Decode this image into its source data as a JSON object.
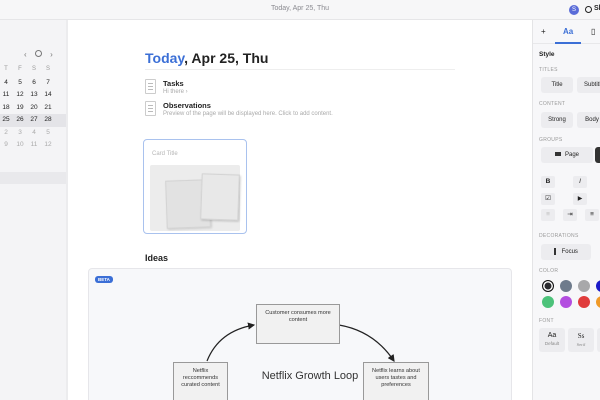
{
  "header": {
    "title": "Today, Apr 25, Thu",
    "avatar": "S",
    "share_label": "Sh"
  },
  "calendar": {
    "weekdays": [
      "T",
      "F",
      "S",
      "S"
    ],
    "weeks": [
      [
        "4",
        "5",
        "6",
        "7"
      ],
      [
        "11",
        "12",
        "13",
        "14"
      ],
      [
        "18",
        "19",
        "20",
        "21"
      ],
      [
        "25",
        "26",
        "27",
        "28"
      ],
      [
        "2",
        "3",
        "4",
        "5"
      ],
      [
        "9",
        "10",
        "11",
        "12"
      ]
    ]
  },
  "doc": {
    "title_highlight": "Today",
    "title_rest": ", Apr 25, Thu",
    "tasks": {
      "title": "Tasks",
      "subtitle": "Hi there ›"
    },
    "observations": {
      "title": "Observations",
      "subtitle": "Preview of the page will be displayed here. Click to add content."
    },
    "card_title": "Card Title",
    "ideas_heading": "Ideas"
  },
  "whiteboard": {
    "badge": "BETA",
    "box_top": "Customer consumes more content",
    "box_left": "Netflix reccommends curated content",
    "box_right": "Netflix learns about users tastes and preferences",
    "title": "Netflix Growth Loop"
  },
  "panel": {
    "tab_add": "+",
    "tab_text": "Aa",
    "section_title": "Style",
    "titles_label": "TITLES",
    "title_btn": "Title",
    "subtitle_btn": "Subtitle",
    "content_label": "CONTENT",
    "strong_btn": "Strong",
    "body_btn": "Body",
    "groups_label": "GROUPS",
    "page_btn": "Page",
    "bold": "B",
    "italic": "I",
    "decorations_label": "DECORATIONS",
    "focus_btn": "Focus",
    "color_label": "COLOR",
    "swatches": [
      "#2a2a2e",
      "#6e7b8c",
      "#a8a8aa",
      "#1a19c8",
      "#4cc27a",
      "#b34ee0",
      "#e03c3c",
      "#f09a28"
    ],
    "font_label": "FONT",
    "font_default": {
      "glyph": "Aa",
      "name": "Default"
    },
    "font_serif": {
      "glyph": "Ss",
      "name": "Serif"
    }
  }
}
